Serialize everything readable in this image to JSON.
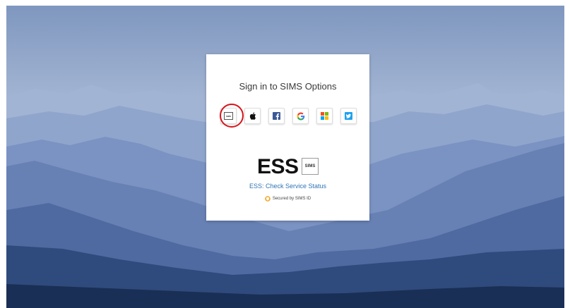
{
  "login": {
    "title": "Sign in to SIMS Options",
    "providers": [
      {
        "name": "SIMS",
        "icon": "sims-id-icon"
      },
      {
        "name": "Apple",
        "icon": "apple-icon"
      },
      {
        "name": "Facebook",
        "icon": "facebook-icon"
      },
      {
        "name": "Google",
        "icon": "google-icon"
      },
      {
        "name": "Microsoft",
        "icon": "microsoft-icon"
      },
      {
        "name": "Twitter",
        "icon": "twitter-icon"
      }
    ],
    "sims_tile_label": "SIMS",
    "ess_logo": "ESS",
    "sims_logo": "SIMS",
    "status_prefix": "ESS: ",
    "status_link": "Check Service Status",
    "secured_text": "Secured by SIMS ID"
  },
  "colors": {
    "highlight": "#d8141c",
    "link": "#2e74b5",
    "facebook": "#3b5998",
    "twitter": "#1da1f2",
    "google_blue": "#4285f4",
    "google_red": "#ea4335",
    "google_yellow": "#fbbc05",
    "google_green": "#34a853",
    "ms_red": "#f25022",
    "ms_green": "#7fba00",
    "ms_blue": "#00a4ef",
    "ms_yellow": "#ffb900"
  }
}
